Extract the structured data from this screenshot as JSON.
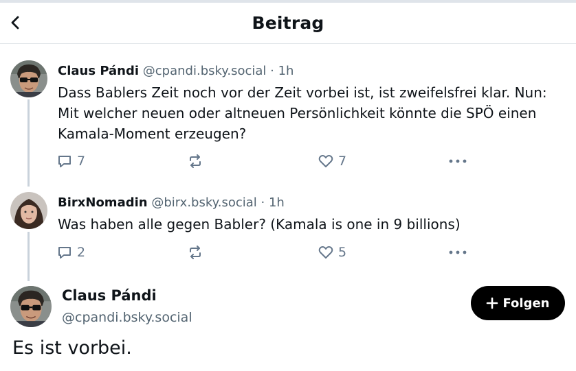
{
  "header": {
    "title": "Beitrag",
    "back_icon": "chevron-left-icon"
  },
  "posts": [
    {
      "author": "Claus Pándi",
      "handle": "@cpandi.bsky.social",
      "separator": "·",
      "time": "1h",
      "text": "Dass Bablers Zeit noch vor der Zeit vorbei ist, ist zweifelsfrei klar. Nun: Mit welcher neuen oder altneuen Persönlichkeit könnte die SPÖ einen Kamala-Moment erzeugen?",
      "replies": "7",
      "likes": "7"
    },
    {
      "author": "BirxNomadin",
      "handle": "@birx.bsky.social",
      "separator": "·",
      "time": "1h",
      "text": "Was haben alle gegen Babler? (Kamala is one in 9 billions)",
      "replies": "2",
      "likes": "5"
    }
  ],
  "main_post": {
    "author": "Claus Pándi",
    "handle": "@cpandi.bsky.social",
    "text": "Es ist vorbei.",
    "follow_label": "Folgen"
  },
  "colors": {
    "accent": "#000000",
    "muted": "#536471",
    "icon": "#64768a",
    "thread_line": "#c9d2db"
  }
}
